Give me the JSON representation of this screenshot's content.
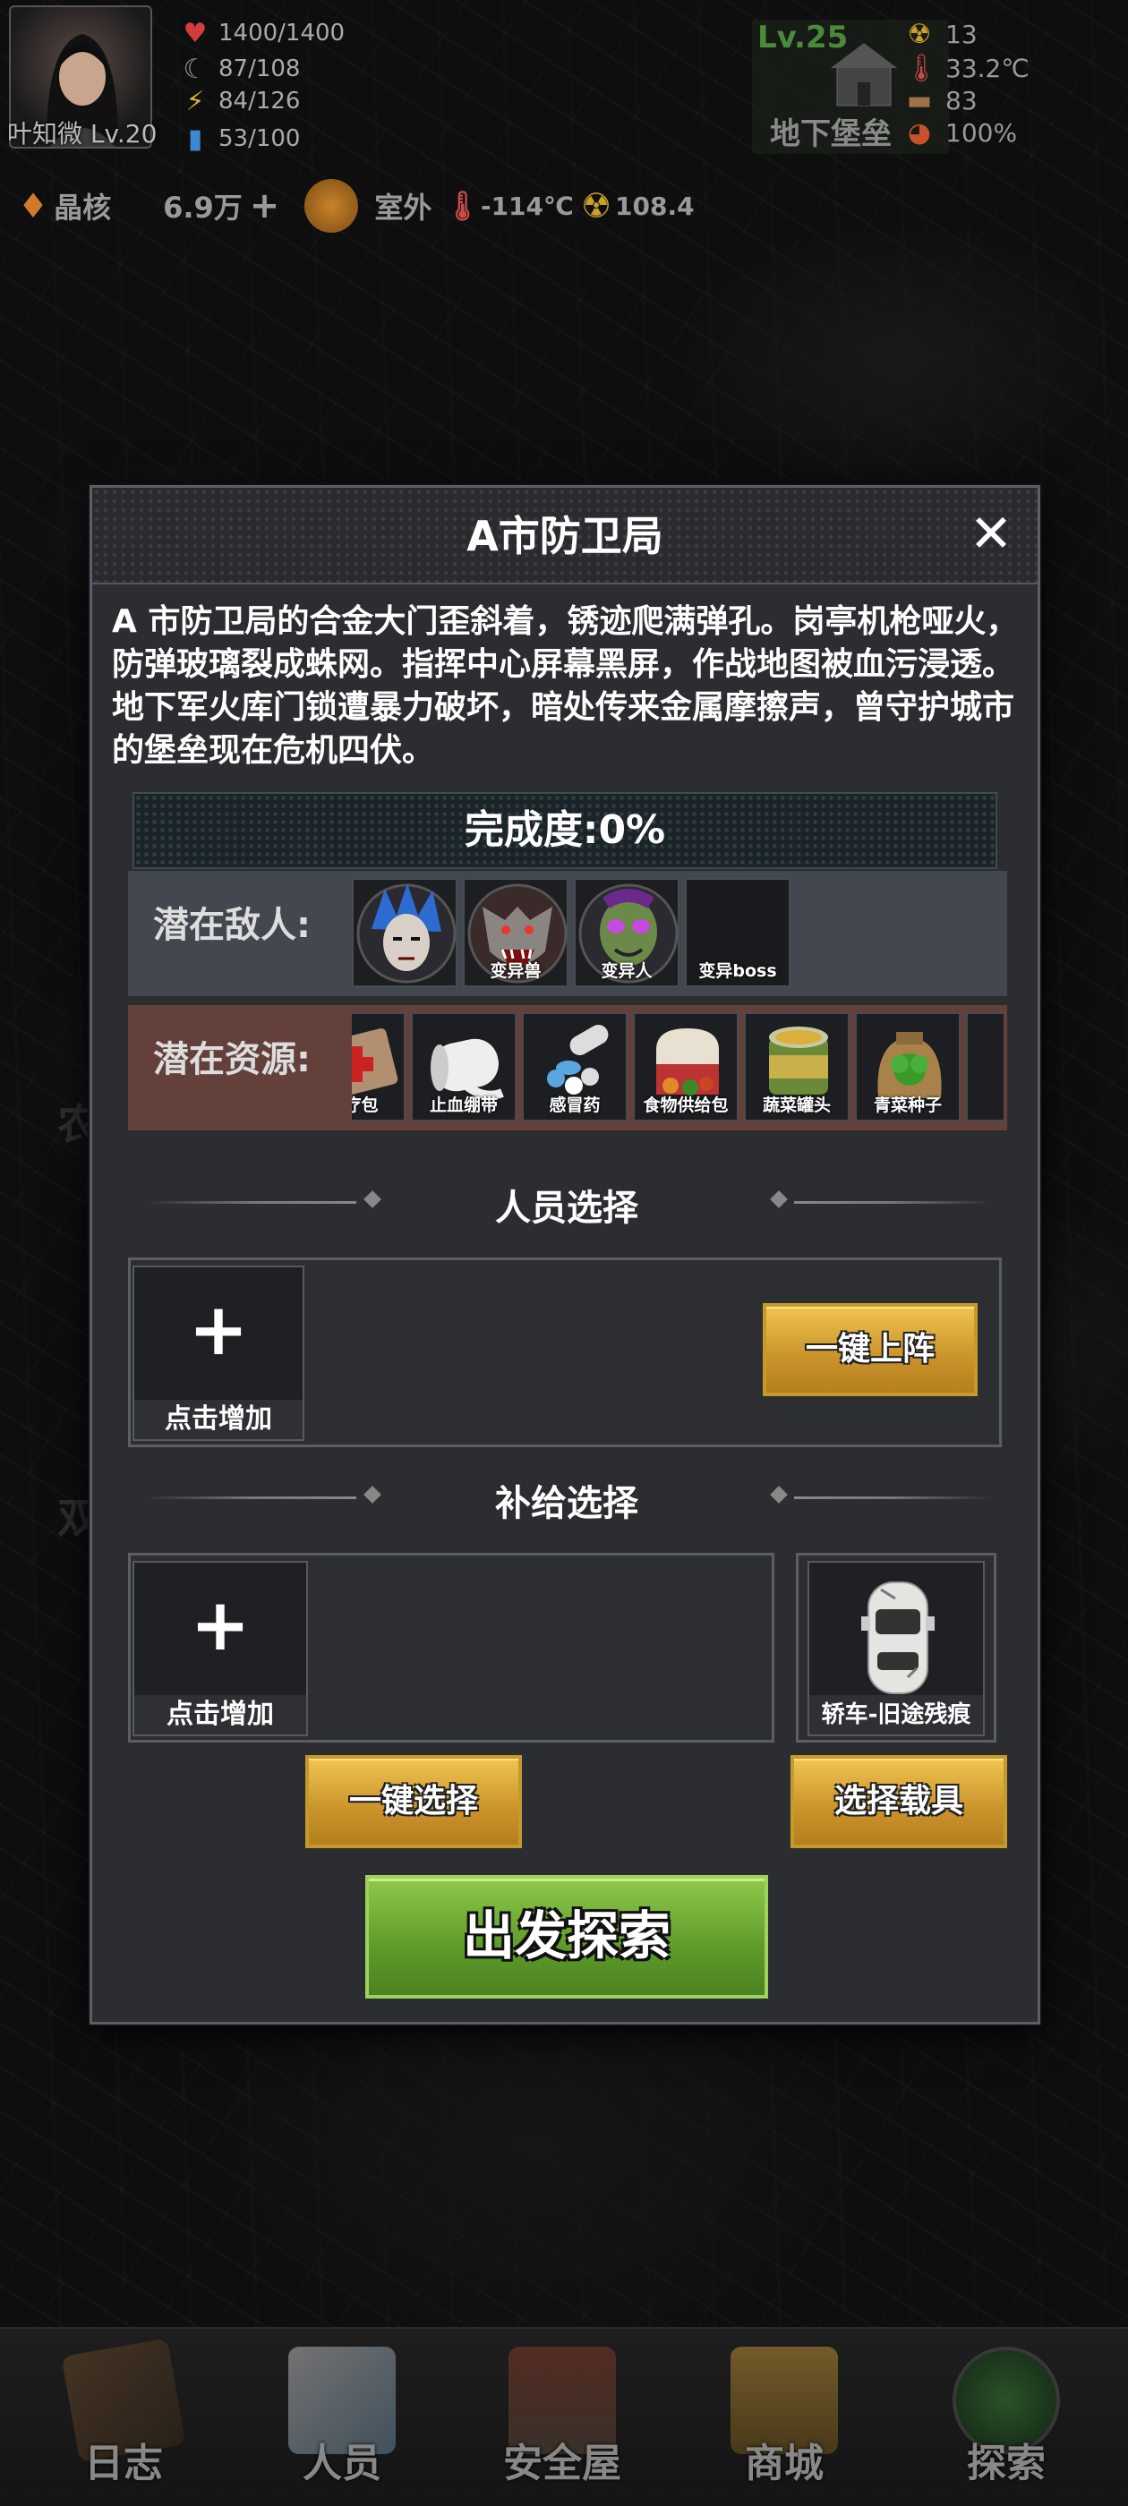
{
  "player": {
    "name_level": "叶知微 Lv.20"
  },
  "stats": [
    {
      "icon": "heart-icon",
      "value": "1400/1400",
      "color": "#d23c3c"
    },
    {
      "icon": "stomach-icon",
      "value": "87/108",
      "color": "#c84a4a"
    },
    {
      "icon": "energy-icon",
      "value": "84/126",
      "color": "#d4b23a"
    },
    {
      "icon": "water-icon",
      "value": "53/100",
      "color": "#3a8ad4"
    }
  ],
  "base": {
    "level": "Lv.25",
    "name": "地下堡垒"
  },
  "environment": [
    {
      "icon": "radiation-icon",
      "value": "13"
    },
    {
      "icon": "thermometer-icon",
      "value": "33.2℃"
    },
    {
      "icon": "bread-icon",
      "value": "83"
    },
    {
      "icon": "pie-icon",
      "value": "100%"
    }
  ],
  "resources": {
    "crystal_label": "晶核",
    "crystal_value": "6.9万",
    "location": "室外",
    "temperature": "-114℃",
    "radiation": "108.4"
  },
  "map_labels": [
    "农",
    "双"
  ],
  "modal": {
    "title": "A市防卫局",
    "description": "A 市防卫局的合金大门歪斜着，锈迹爬满弹孔。岗亭机枪哑火，防弹玻璃裂成蛛网。指挥中心屏幕黑屏，作战地图被血污浸透。地下军火库门锁遭暴力破坏，暗处传来金属摩擦声，曾守护城市的堡垒现在危机四伏。",
    "progress": "完成度:0%",
    "enemy_label": "潜在敌人:",
    "enemies": [
      {
        "name": "",
        "icon": "mutant-punk-icon"
      },
      {
        "name": "变异兽",
        "icon": "mutant-beast-icon"
      },
      {
        "name": "变异人",
        "icon": "mutant-human-icon"
      },
      {
        "name": "变异boss",
        "icon": "mutant-boss-icon"
      }
    ],
    "resource_label": "潜在资源:",
    "resources": [
      {
        "name": "医疗包",
        "icon": "medkit-icon"
      },
      {
        "name": "止血绷带",
        "icon": "bandage-icon"
      },
      {
        "name": "感冒药",
        "icon": "pills-icon"
      },
      {
        "name": "食物供给包",
        "icon": "food-pack-icon"
      },
      {
        "name": "蔬菜罐头",
        "icon": "canned-veg-icon"
      },
      {
        "name": "青菜种子",
        "icon": "seed-bag-icon"
      }
    ],
    "personnel_title": "人员选择",
    "personnel_add": "点击增加",
    "auto_deploy": "一键上阵",
    "supply_title": "补给选择",
    "supply_add": "点击增加",
    "vehicle_name": "轿车-旧途残痕",
    "auto_select": "一键选择",
    "select_vehicle": "选择载具",
    "depart": "出发探索"
  },
  "nav": [
    {
      "label": "日志",
      "icon": "journal-icon"
    },
    {
      "label": "人员",
      "icon": "id-card-icon"
    },
    {
      "label": "安全屋",
      "icon": "house-icon"
    },
    {
      "label": "商城",
      "icon": "basket-icon"
    },
    {
      "label": "探索",
      "icon": "radar-icon"
    }
  ]
}
